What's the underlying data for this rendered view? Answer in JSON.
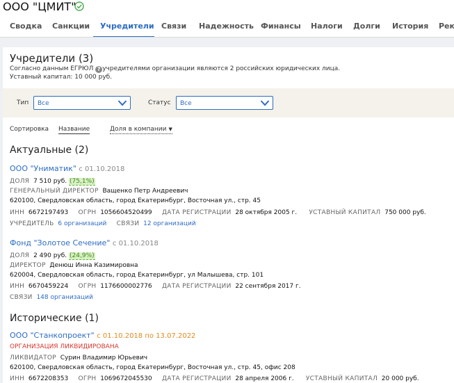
{
  "header": {
    "company_name": "ООО \"ЦМИТ\"",
    "tabs": [
      {
        "label": "Сводка"
      },
      {
        "label": "Санкции"
      },
      {
        "label": "Учредители"
      },
      {
        "label": "Связи"
      },
      {
        "label": "Надежность"
      },
      {
        "label": "Финансы"
      },
      {
        "label": "Налоги"
      },
      {
        "label": "Долги"
      },
      {
        "label": "История"
      },
      {
        "label": "Рекл"
      }
    ],
    "active_tab": "Учредители"
  },
  "founders": {
    "title": "Учредители (3)",
    "description_prefix": "Согласно данным ЕГРЮЛ",
    "description_suffix": "учредителями организации являются 2 российских юридических лица.",
    "capital": "Уставный капитал: 10 000 руб."
  },
  "filters": {
    "type_label": "Тип",
    "type_value": "Все",
    "status_label": "Статус",
    "status_value": "Все"
  },
  "sorting": {
    "label": "Сортировка",
    "by_name": "Название",
    "by_share": "Доля в компании"
  },
  "current": {
    "title": "Актуальные (2)",
    "items": [
      {
        "name": "ООО \"Униматик\"",
        "since": "с 01.10.2018",
        "share_label": "ДОЛЯ",
        "share_value": "7 510 руб.",
        "share_percent": "(75,1%)",
        "role": "ГЕНЕРАЛЬНЫЙ ДИРЕКТОР",
        "person": "Ващенко Петр Андреевич",
        "address": "620100, Свердловская область, город Екатеринбург, Восточная ул., стр. 45",
        "inn_label": "ИНН",
        "inn": "6672197493",
        "ogrn_label": "ОГРН",
        "ogrn": "1056604520499",
        "reg_label": "ДАТА РЕГИСТРАЦИИ",
        "reg": "28 октября 2005 г.",
        "cap_label": "УСТАВНЫЙ КАПИТАЛ",
        "cap": "750 000 руб.",
        "founder_label": "УЧРЕДИТЕЛЬ",
        "founder_value": "6 организаций",
        "links_label": "СВЯЗИ",
        "links_value": "12 организаций"
      },
      {
        "name": "Фонд \"Золотое Сечение\"",
        "since": "с 01.10.2018",
        "share_label": "ДОЛЯ",
        "share_value": "2 490 руб.",
        "share_percent": "(24,9%)",
        "role": "ДИРЕКТОР",
        "person": "Денюш Инна Казимировна",
        "address": "620004, Свердловская область, город Екатеринбург, ул Малышева, стр. 101",
        "inn_label": "ИНН",
        "inn": "6670459224",
        "ogrn_label": "ОГРН",
        "ogrn": "1176600002776",
        "reg_label": "ДАТА РЕГИСТРАЦИИ",
        "reg": "22 сентября 2017 г.",
        "links_label": "СВЯЗИ",
        "links_value": "148 организаций"
      }
    ]
  },
  "historical": {
    "title": "Исторические (1)",
    "items": [
      {
        "name": "ООО \"Станкопроект\"",
        "since": "с 01.10.2018 по 13.07.2022",
        "status": "ОРГАНИЗАЦИЯ ЛИКВИДИРОВАНА",
        "role": "ЛИКВИДАТОР",
        "person": "Сурин Владимир Юрьевич",
        "address": "620100, Свердловская область, город Екатеринбург, Восточная ул., стр. 45, офис 208",
        "inn_label": "ИНН",
        "inn": "6672208353",
        "ogrn_label": "ОГРН",
        "ogrn": "1069672045530",
        "reg_label": "ДАТА РЕГИСТРАЦИИ",
        "reg": "28 апреля 2006 г.",
        "cap_label": "УСТАВНЫЙ КАПИТАЛ",
        "cap": "20 000 руб."
      }
    ]
  },
  "colors": {
    "accent": "#2c6cc4",
    "verified": "#4caf50",
    "liquidated": "#d9362b",
    "historical_date": "#e08a1e",
    "share_badge_bg": "#d9f0c3",
    "filter_bg": "#f4f2ea"
  },
  "icons": {
    "verified": "check-circle-icon",
    "info": "info-icon",
    "dropdown": "chevron-down-icon",
    "sort": "caret-down-icon"
  }
}
